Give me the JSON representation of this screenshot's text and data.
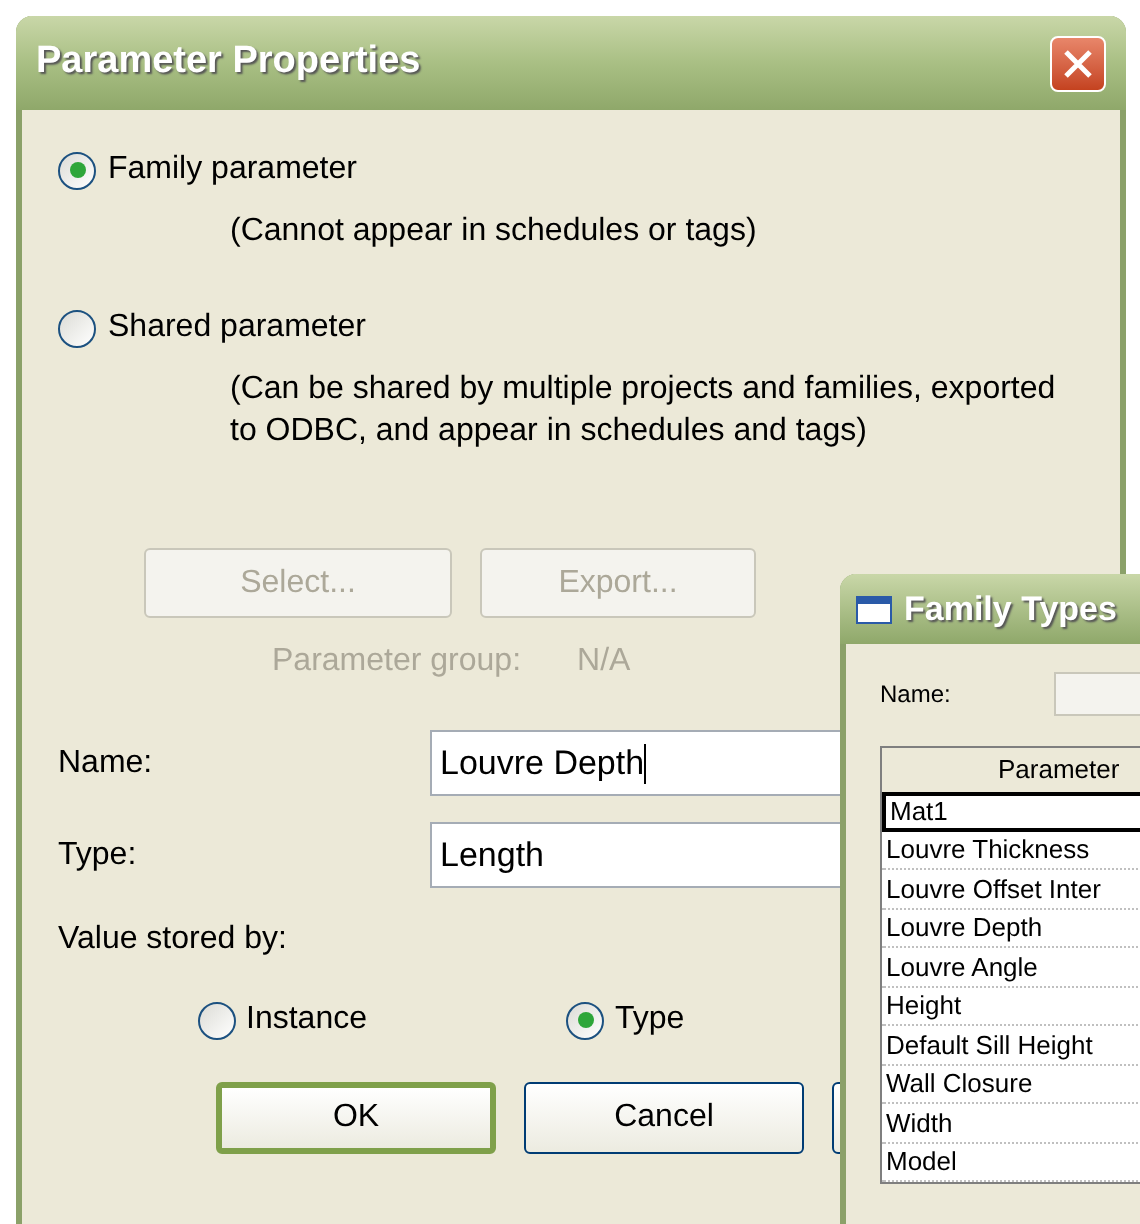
{
  "dialog": {
    "title": "Parameter Properties"
  },
  "parameter_types": [
    {
      "label": "Family parameter",
      "selected": true,
      "description": [
        "(Cannot appear in schedules or tags)"
      ]
    },
    {
      "label": "Shared parameter",
      "selected": false,
      "description": [
        "(Can be shared by multiple projects and families, exported",
        "to ODBC, and appear in schedules and tags)"
      ]
    }
  ],
  "shared_buttons": [
    {
      "label": "Select...",
      "disabled": true
    },
    {
      "label": "Export...",
      "disabled": true
    }
  ],
  "parameter_group": {
    "label": "Parameter group:",
    "value": "N/A",
    "disabled": true
  },
  "fields": [
    {
      "label": "Name:",
      "value": "Louvre Depth"
    },
    {
      "label": "Type:",
      "value": "Length"
    }
  ],
  "value_stored_by": {
    "label": "Value stored by:",
    "options": [
      {
        "label": "Instance",
        "selected": false
      },
      {
        "label": "Type",
        "selected": true
      }
    ]
  },
  "buttons": [
    {
      "label": "OK",
      "default": true
    },
    {
      "label": "Cancel",
      "default": false
    }
  ],
  "family_types": {
    "title": "Family Types",
    "name_label": "Name:",
    "column": "Parameter",
    "rows": [
      {
        "text": "Mat1",
        "selected": true
      },
      {
        "text": "Louvre Thickness",
        "selected": false
      },
      {
        "text": "Louvre Offset Inter",
        "selected": false
      },
      {
        "text": "Louvre Depth",
        "selected": false
      },
      {
        "text": "Louvre Angle",
        "selected": false
      },
      {
        "text": "Height",
        "selected": false
      },
      {
        "text": "Default Sill Height",
        "selected": false
      },
      {
        "text": "Wall Closure",
        "selected": false
      },
      {
        "text": "Width",
        "selected": false
      },
      {
        "text": "Model",
        "selected": false
      }
    ]
  }
}
